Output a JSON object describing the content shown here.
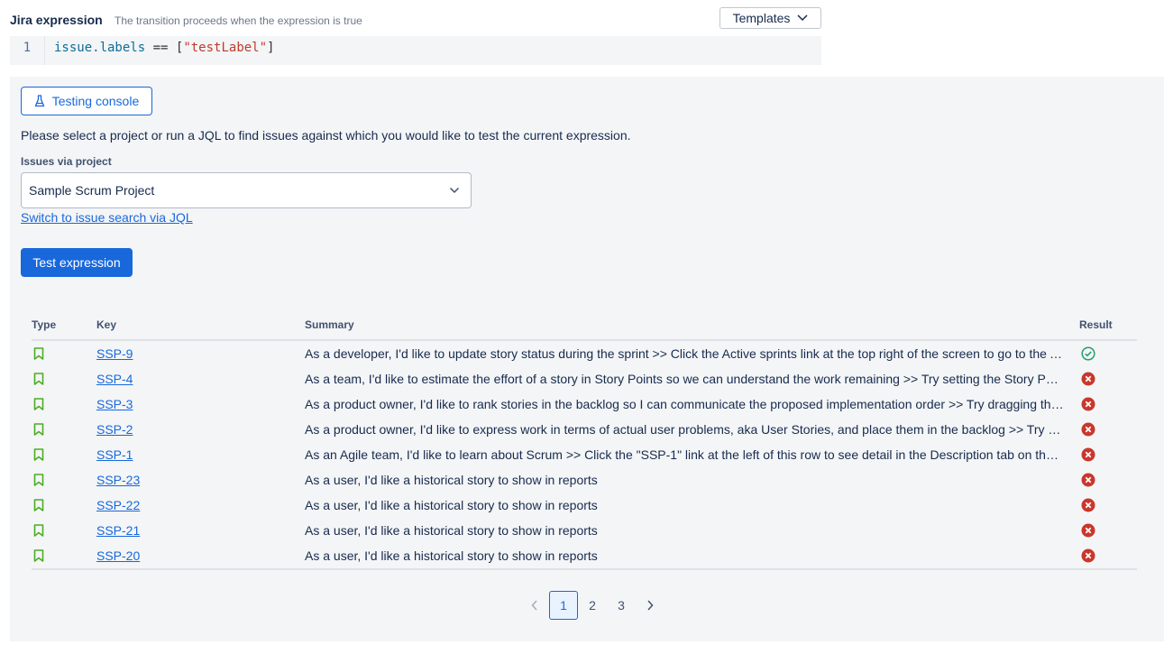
{
  "header": {
    "title": "Jira expression",
    "subtitle": "The transition proceeds when the expression is true",
    "templates_label": "Templates"
  },
  "editor": {
    "line_number": "1",
    "code_var": "issue.labels",
    "code_op": " == [",
    "code_str": "\"testLabel\"",
    "code_end": "]"
  },
  "console": {
    "button_label": "Testing console",
    "instructions": "Please select a project or run a JQL to find issues against which you would like to test the current expression.",
    "field_label": "Issues via project",
    "selected_project": "Sample Scrum Project",
    "switch_link": "Switch to issue search via JQL",
    "test_button": "Test expression"
  },
  "table": {
    "headers": {
      "type": "Type",
      "key": "Key",
      "summary": "Summary",
      "result": "Result"
    },
    "rows": [
      {
        "type_icon": "story-icon",
        "key": "SSP-9",
        "summary": "As a developer, I'd like to update story status during the sprint >> Click the Active sprints link at the top right of the screen to go to the Active sprints view",
        "result": "pass"
      },
      {
        "type_icon": "story-icon",
        "key": "SSP-4",
        "summary": "As a team, I'd like to estimate the effort of a story in Story Points so we can understand the work remaining >> Try setting the Story Point estimate",
        "result": "fail"
      },
      {
        "type_icon": "story-icon",
        "key": "SSP-3",
        "summary": "As a product owner, I'd like to rank stories in the backlog so I can communicate the proposed implementation order >> Try dragging this story up above the previous story",
        "result": "fail"
      },
      {
        "type_icon": "story-icon",
        "key": "SSP-2",
        "summary": "As a product owner, I'd like to express work in terms of actual user problems, aka User Stories, and place them in the backlog >> Try creating a new story",
        "result": "fail"
      },
      {
        "type_icon": "story-icon",
        "key": "SSP-1",
        "summary": "As an Agile team, I'd like to learn about Scrum >> Click the \"SSP-1\" link at the left of this row to see detail in the Description tab on the right",
        "result": "fail"
      },
      {
        "type_icon": "story-icon",
        "key": "SSP-23",
        "summary": "As a user, I'd like a historical story to show in reports",
        "result": "fail"
      },
      {
        "type_icon": "story-icon",
        "key": "SSP-22",
        "summary": "As a user, I'd like a historical story to show in reports",
        "result": "fail"
      },
      {
        "type_icon": "story-icon",
        "key": "SSP-21",
        "summary": "As a user, I'd like a historical story to show in reports",
        "result": "fail"
      },
      {
        "type_icon": "story-icon",
        "key": "SSP-20",
        "summary": "As a user, I'd like a historical story to show in reports",
        "result": "fail"
      }
    ]
  },
  "pagination": {
    "pages": [
      "1",
      "2",
      "3"
    ],
    "current": "1"
  },
  "colors": {
    "primary": "#1868db",
    "pass": "#22a06b",
    "fail": "#c9372c",
    "story": "#4bad23"
  }
}
